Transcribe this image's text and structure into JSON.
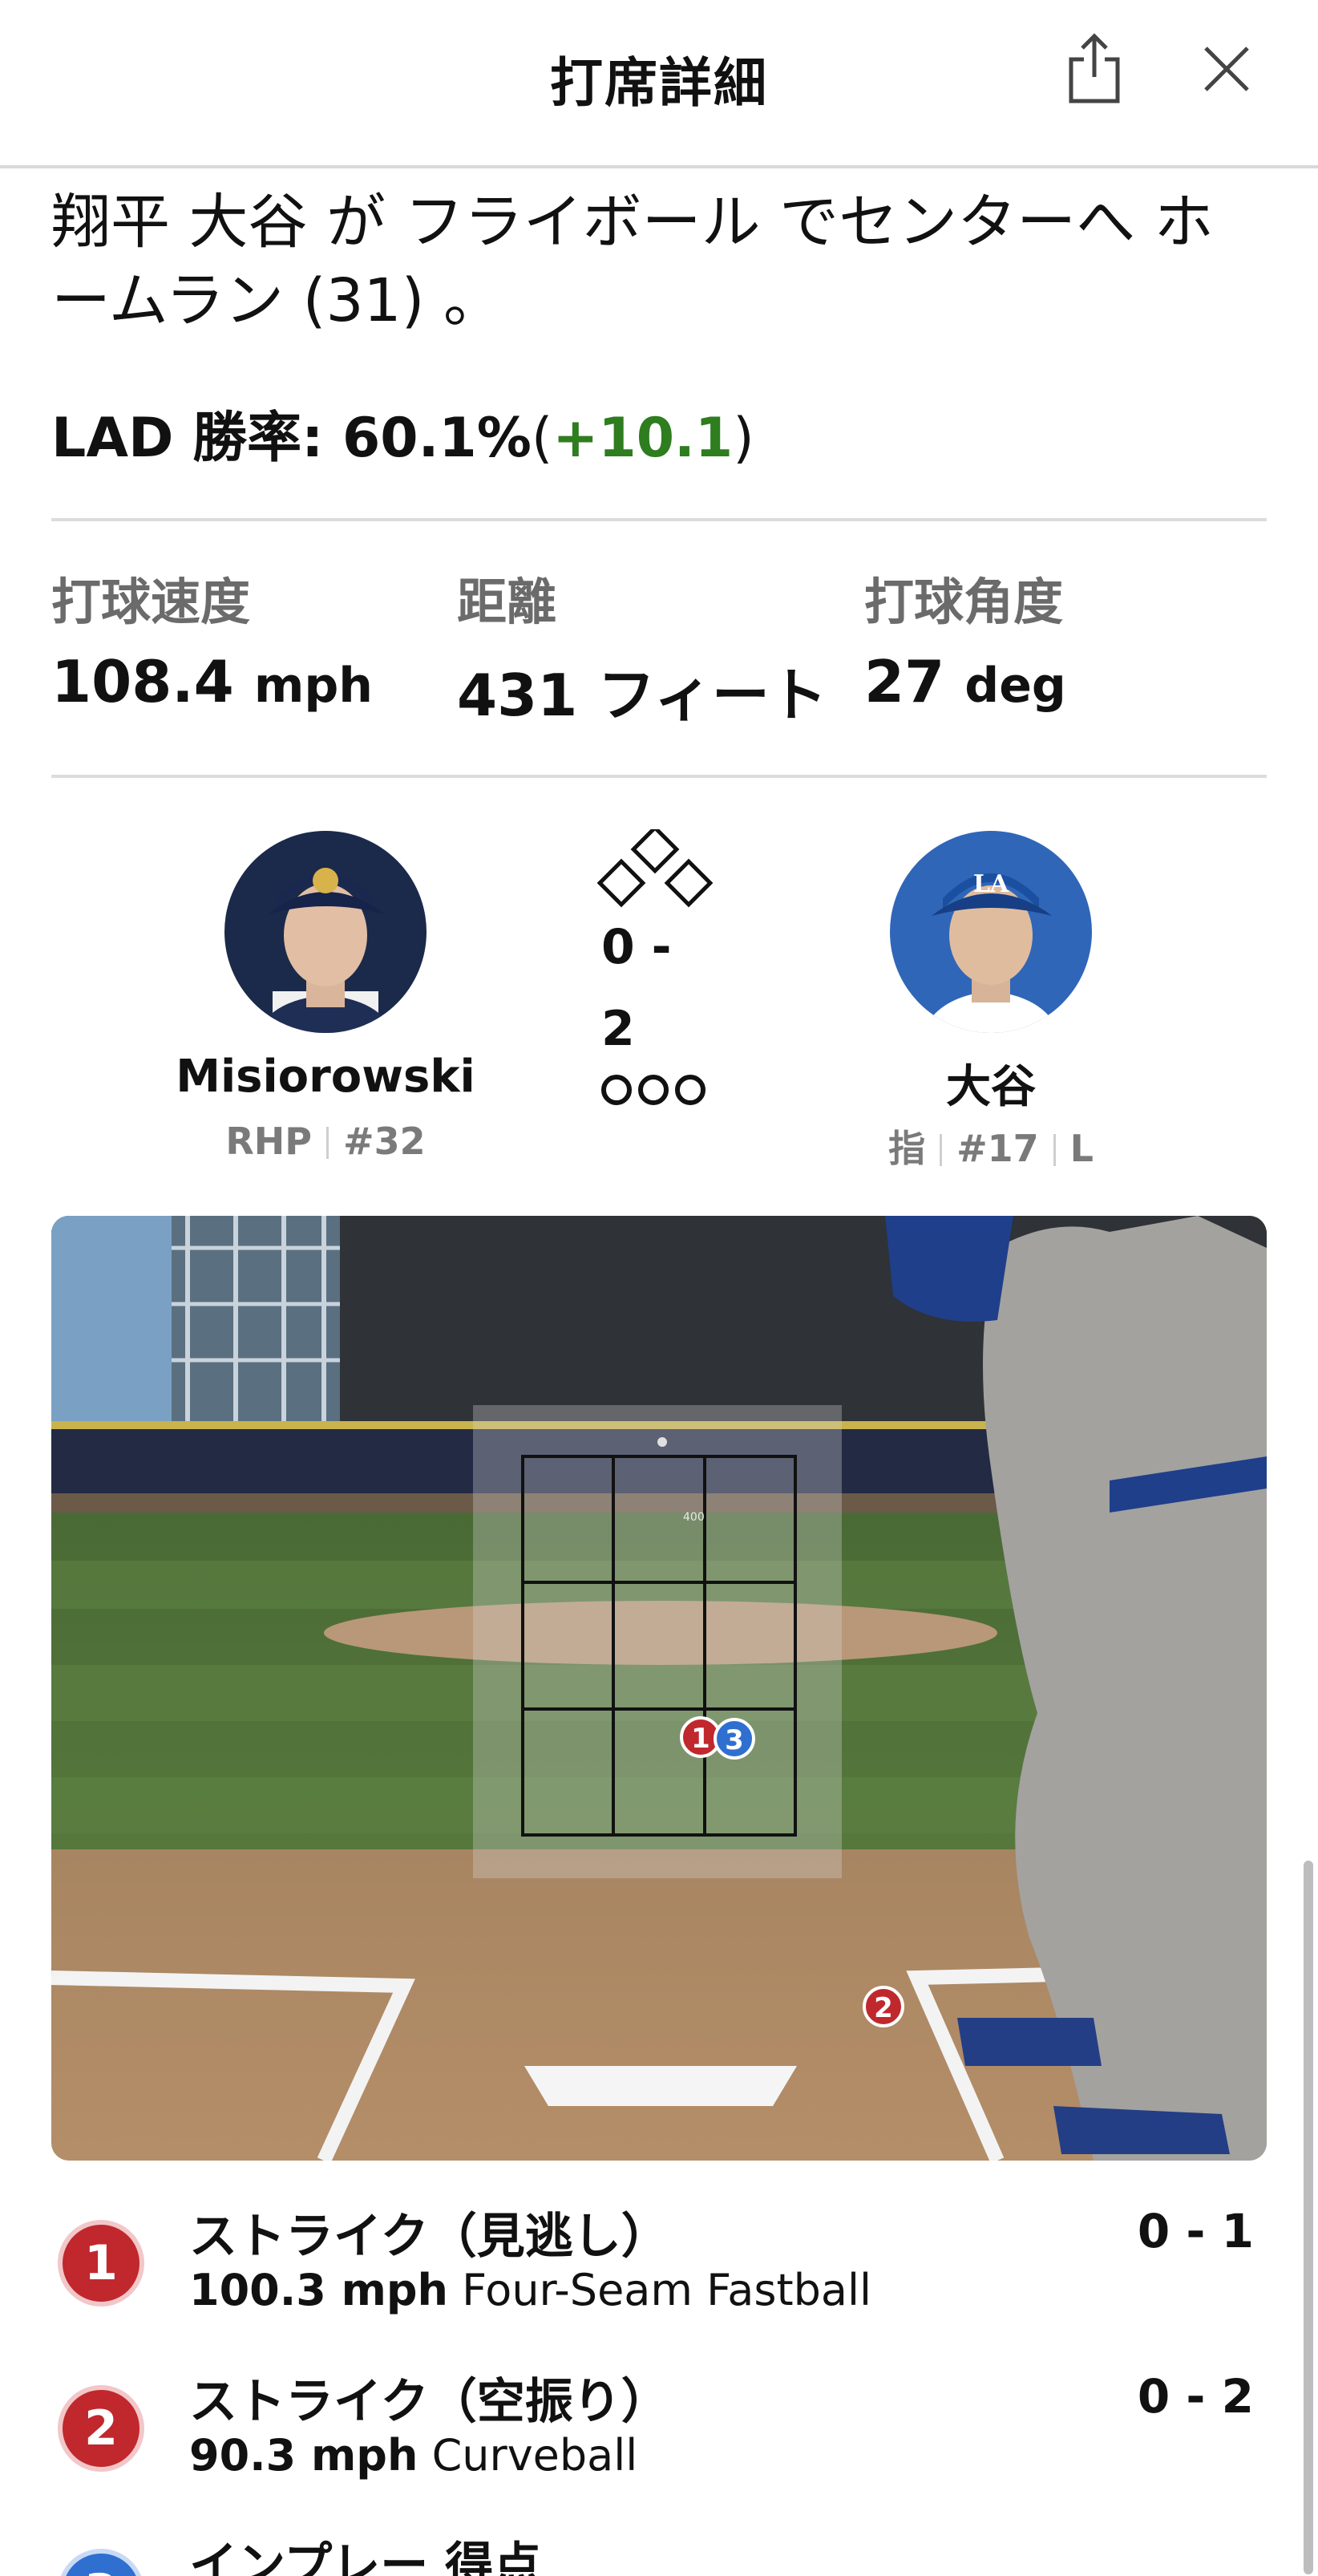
{
  "header": {
    "title": "打席詳細"
  },
  "play": {
    "description": "翔平 大谷 が フライボール でセンターへ ホームラン (31) 。",
    "win_prob": {
      "team_label": "LAD 勝率:",
      "value": "60.1%",
      "delta": "+10.1"
    }
  },
  "stats": [
    {
      "label": "打球速度",
      "value": "108.4",
      "unit": "mph"
    },
    {
      "label": "距離",
      "value": "431",
      "unit": "フィート"
    },
    {
      "label": "打球角度",
      "value": "27",
      "unit": "deg"
    }
  ],
  "matchup": {
    "pitcher": {
      "name": "Misiorowski",
      "hand": "RHP",
      "number": "#32"
    },
    "batter": {
      "name": "大谷",
      "position": "指",
      "number": "#17",
      "bats": "L"
    },
    "count_top": "0 -",
    "count_bottom": "2"
  },
  "pitch_view": {
    "zone_label": "400"
  },
  "pitches": [
    {
      "num": "1",
      "result": "ストライク（見逃し）",
      "speed": "100.3 mph",
      "type": "Four-Seam Fastball",
      "count": "0 - 1",
      "color": "#c0282d"
    },
    {
      "num": "2",
      "result": "ストライク（空振り）",
      "speed": "90.3 mph",
      "type": "Curveball",
      "count": "0 - 2",
      "color": "#c0282d"
    },
    {
      "num": "3",
      "result": "インプレー 得点",
      "color": "#2f6fd0"
    }
  ]
}
